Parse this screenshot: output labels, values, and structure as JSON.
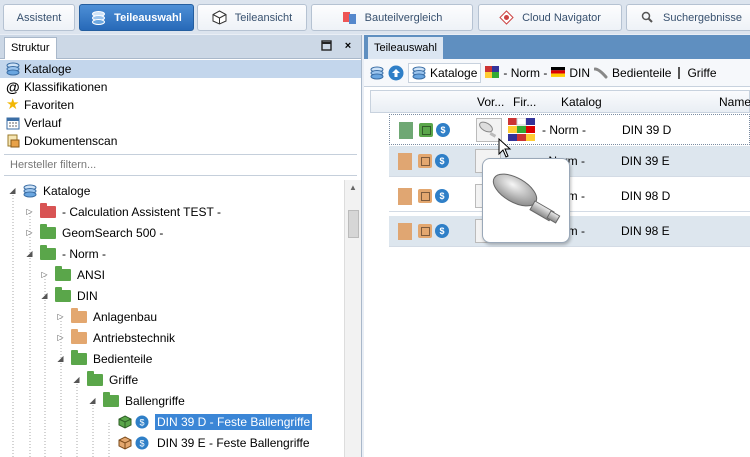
{
  "tabs": [
    {
      "label": "Assistent",
      "icon": "none",
      "active": false
    },
    {
      "label": "Teileauswahl",
      "icon": "catalog-icon",
      "active": true
    },
    {
      "label": "Teileansicht",
      "icon": "part-view-icon",
      "active": false
    },
    {
      "label": "Bauteilvergleich",
      "icon": "compare-icon",
      "active": false
    },
    {
      "label": "Cloud Navigator",
      "icon": "cloud-icon",
      "active": false
    },
    {
      "label": "Suchergebnisse",
      "icon": "search-icon",
      "active": false
    }
  ],
  "left_panel": {
    "tab_label": "Struktur",
    "nav_items": [
      {
        "label": "Kataloge",
        "icon": "catalog-icon",
        "selected": true
      },
      {
        "label": "Klassifikationen",
        "icon": "at-icon",
        "selected": false
      },
      {
        "label": "Favoriten",
        "icon": "star-icon",
        "selected": false
      },
      {
        "label": "Verlauf",
        "icon": "calendar-icon",
        "selected": false
      },
      {
        "label": "Dokumentenscan",
        "icon": "document-scan-icon",
        "selected": false
      }
    ],
    "filter_placeholder": "Hersteller filtern...",
    "tree": [
      {
        "label": "Kataloge"
      },
      {
        "label": "- Calculation Assistent TEST -"
      },
      {
        "label": "GeomSearch 500 -"
      },
      {
        "label": "- Norm -"
      },
      {
        "label": "ANSI"
      },
      {
        "label": "DIN"
      },
      {
        "label": "Anlagenbau"
      },
      {
        "label": "Antriebstechnik"
      },
      {
        "label": "Bedienteile"
      },
      {
        "label": "Griffe"
      },
      {
        "label": "Ballengriffe"
      },
      {
        "label": "DIN 39 D - Feste Ballengriffe"
      },
      {
        "label": "DIN 39 E - Feste Ballengriffe"
      }
    ]
  },
  "right_panel": {
    "tab_label": "Teileauswahl",
    "breadcrumb": [
      "Kataloge",
      "- Norm -",
      "DIN",
      "Bedienteile",
      "Griffe"
    ],
    "columns": {
      "preview": "Vor...",
      "manufacturer": "Fir...",
      "catalog": "Katalog",
      "name": "Name"
    },
    "rows": [
      {
        "catalog": "- Norm -",
        "name": "DIN 39 D",
        "status_color": "#6fa874",
        "cube_color": "#5aa64a"
      },
      {
        "catalog": "- Norm -",
        "name": "DIN 39 E",
        "status_color": "#e0a672",
        "cube_color": "#e3a76f"
      },
      {
        "catalog": "- Norm -",
        "name": "DIN 98 D",
        "status_color": "#e0a672",
        "cube_color": "#e3a76f"
      },
      {
        "catalog": "- Norm -",
        "name": "DIN 98 E",
        "status_color": "#e0a672",
        "cube_color": "#e3a76f"
      }
    ]
  },
  "colors": {
    "accent": "#2769b8",
    "selection": "#3b86d6"
  }
}
